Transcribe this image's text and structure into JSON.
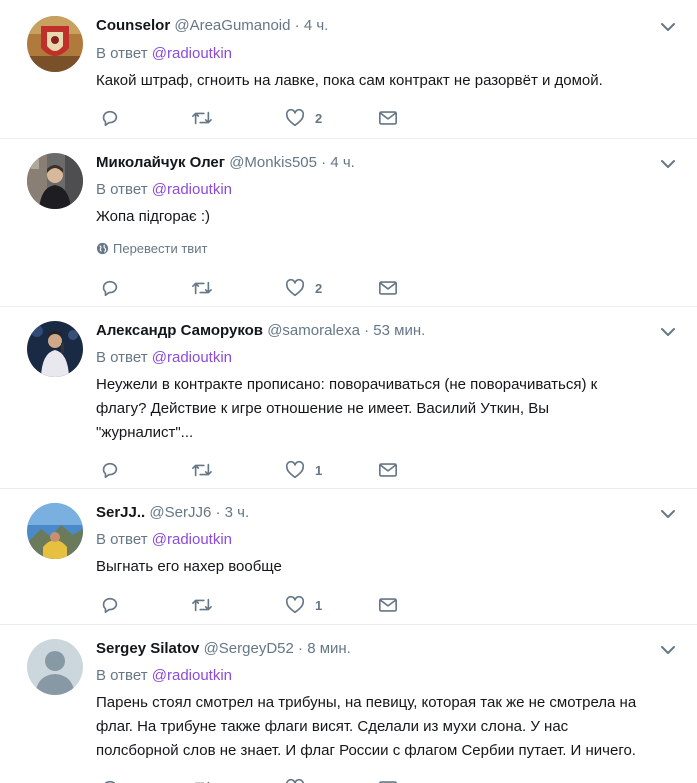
{
  "labels": {
    "reply_prefix": "В ответ",
    "translate": "Перевести твит"
  },
  "tweets": [
    {
      "fullname": "Counselor",
      "username": "@AreaGumanoid",
      "time": "4 ч.",
      "reply_to": "@radioutkin",
      "text": "Какой штраф, сгноить на лавке, пока сам контракт не разорвёт и домой.",
      "likes": "2",
      "avatar_icon": "shield-flag-avatar"
    },
    {
      "fullname": "Миколайчук Олег",
      "username": "@Monkis505",
      "time": "4 ч.",
      "reply_to": "@radioutkin",
      "text": "Жопа підгорає :)",
      "likes": "2",
      "avatar_icon": "man-in-street-avatar"
    },
    {
      "fullname": "Александр Саморуков",
      "username": "@samoralexa",
      "time": "53 мин.",
      "reply_to": "@radioutkin",
      "text_lines": [
        "Неужели в контракте прописано: поворачиваться (не поворачиваться) к",
        "флагу? Действие к игре отношение не имеет. Василий Уткин, Вы",
        "\"журналист\"..."
      ],
      "likes": "1",
      "avatar_icon": "singer-on-stage-avatar"
    },
    {
      "fullname": "SerJJ..",
      "username": "@SerJJ6",
      "time": "3 ч.",
      "reply_to": "@radioutkin",
      "text": "Выгнать его нахер вообще",
      "likes": "1",
      "avatar_icon": "mountain-sky-avatar"
    },
    {
      "fullname": "Sergey Silatov",
      "username": "@SergeyD52",
      "time": "8 мин.",
      "reply_to": "@radioutkin",
      "text_lines": [
        "Парень стоял смотрел на трибуны, на певицу, которая так же не смотрела на",
        "флаг. На трибуне также флаги висят. Сделали из мухи слона. У нас",
        "полсборной слов не знает. И флаг России с флагом Сербии путает. И ничего."
      ],
      "avatar_icon": "default-user-avatar"
    }
  ],
  "colors": {
    "mention": "#8c4bd8",
    "secondary_text": "#657786",
    "primary_text": "#14171a",
    "divider": "#e6ecf0"
  }
}
